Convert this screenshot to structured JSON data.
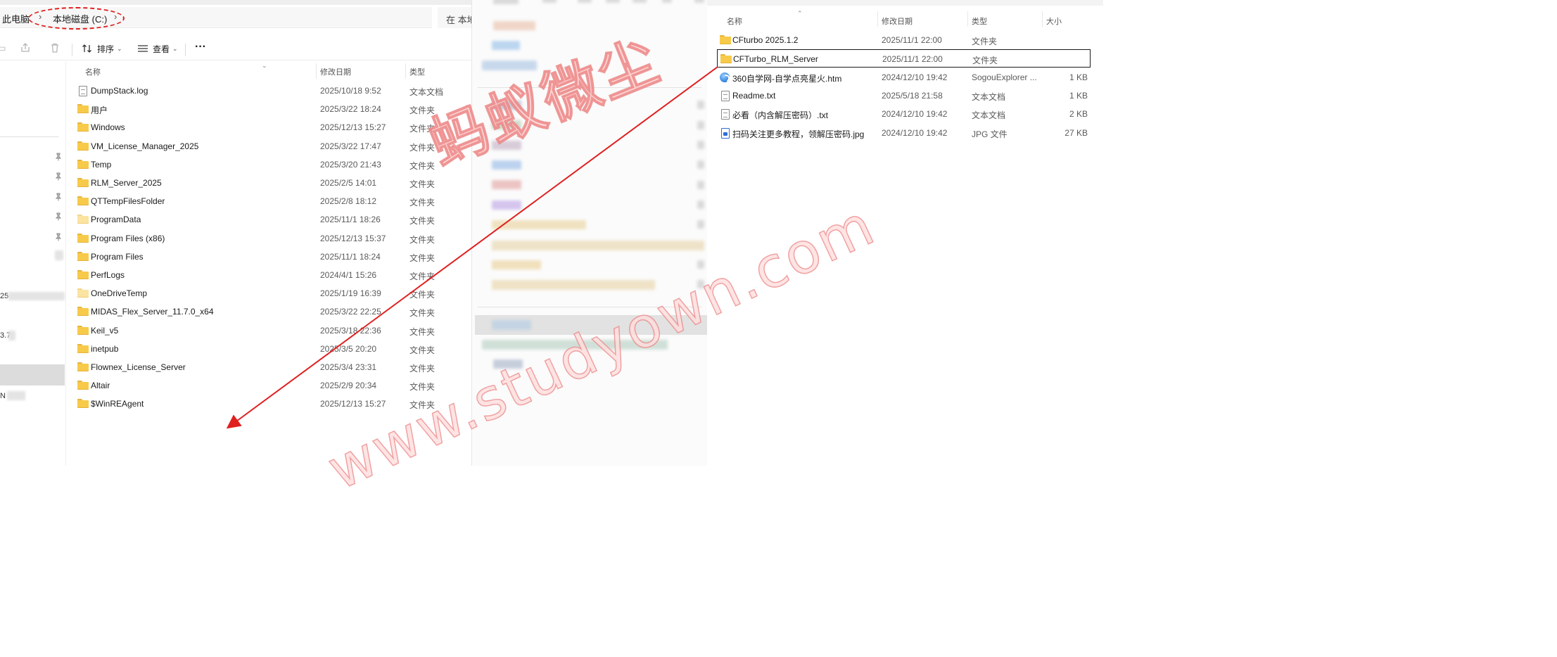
{
  "left": {
    "breadcrumb": [
      "此电脑",
      "本地磁盘 (C:)"
    ],
    "search_placeholder": "在 本地",
    "toolbar": {
      "sort_label": "排序",
      "view_label": "查看",
      "more_label": "···"
    },
    "columns": {
      "name": "名称",
      "date": "修改日期",
      "type": "类型"
    },
    "nav_partial": [
      "25",
      "3.7",
      "N"
    ],
    "files": [
      {
        "name": "DumpStack.log",
        "date": "2025/10/18 9:52",
        "type": "文本文档",
        "icon": "text-file-icon"
      },
      {
        "name": "用户",
        "date": "2025/3/22 18:24",
        "type": "文件夹",
        "icon": "folder-icon"
      },
      {
        "name": "Windows",
        "date": "2025/12/13 15:27",
        "type": "文件夹",
        "icon": "folder-icon"
      },
      {
        "name": "VM_License_Manager_2025",
        "date": "2025/3/22 17:47",
        "type": "文件夹",
        "icon": "folder-icon"
      },
      {
        "name": "Temp",
        "date": "2025/3/20 21:43",
        "type": "文件夹",
        "icon": "folder-icon"
      },
      {
        "name": "RLM_Server_2025",
        "date": "2025/2/5 14:01",
        "type": "文件夹",
        "icon": "folder-icon"
      },
      {
        "name": "QTTempFilesFolder",
        "date": "2025/2/8 18:12",
        "type": "文件夹",
        "icon": "folder-icon"
      },
      {
        "name": "ProgramData",
        "date": "2025/11/1 18:26",
        "type": "文件夹",
        "icon": "folder-light-icon"
      },
      {
        "name": "Program Files (x86)",
        "date": "2025/12/13 15:37",
        "type": "文件夹",
        "icon": "folder-icon"
      },
      {
        "name": "Program Files",
        "date": "2025/11/1 18:24",
        "type": "文件夹",
        "icon": "folder-icon"
      },
      {
        "name": "PerfLogs",
        "date": "2024/4/1 15:26",
        "type": "文件夹",
        "icon": "folder-icon"
      },
      {
        "name": "OneDriveTemp",
        "date": "2025/1/19 16:39",
        "type": "文件夹",
        "icon": "folder-light-icon"
      },
      {
        "name": "MIDAS_Flex_Server_11.7.0_x64",
        "date": "2025/3/22 22:25",
        "type": "文件夹",
        "icon": "folder-icon"
      },
      {
        "name": "Keil_v5",
        "date": "2025/3/18 22:36",
        "type": "文件夹",
        "icon": "folder-icon"
      },
      {
        "name": "inetpub",
        "date": "2025/3/5 20:20",
        "type": "文件夹",
        "icon": "folder-icon"
      },
      {
        "name": "Flownex_License_Server",
        "date": "2025/3/4 23:31",
        "type": "文件夹",
        "icon": "folder-icon"
      },
      {
        "name": "Altair",
        "date": "2025/2/9 20:34",
        "type": "文件夹",
        "icon": "folder-icon"
      },
      {
        "name": "$WinREAgent",
        "date": "2025/12/13 15:27",
        "type": "文件夹",
        "icon": "folder-icon"
      }
    ]
  },
  "right": {
    "columns": {
      "name": "名称",
      "date": "修改日期",
      "type": "类型",
      "size": "大小"
    },
    "files": [
      {
        "name": "CFturbo 2025.1.2",
        "date": "2025/11/1 22:00",
        "type": "文件夹",
        "size": "",
        "icon": "folder-icon"
      },
      {
        "name": "CFTurbo_RLM_Server",
        "date": "2025/11/1 22:00",
        "type": "文件夹",
        "size": "",
        "icon": "folder-icon",
        "selected": true
      },
      {
        "name": "360自学网-自学点亮星火.htm",
        "date": "2024/12/10 19:42",
        "type": "SogouExplorer ...",
        "size": "1 KB",
        "icon": "browser-html-icon"
      },
      {
        "name": "Readme.txt",
        "date": "2025/5/18 21:58",
        "type": "文本文档",
        "size": "1 KB",
        "icon": "text-file-icon"
      },
      {
        "name": "必看（内含解压密码）.txt",
        "date": "2024/12/10 19:42",
        "type": "文本文档",
        "size": "2 KB",
        "icon": "text-file-icon"
      },
      {
        "name": "扫码关注更多教程，领解压密码.jpg",
        "date": "2024/12/10 19:42",
        "type": "JPG 文件",
        "size": "27 KB",
        "icon": "image-file-icon"
      }
    ]
  },
  "watermarks": {
    "chinese": "蚂蚁微尘",
    "url": "www.studyown.com"
  },
  "colors": {
    "annotation_red": "#e02020",
    "folder_yellow": "#f8ca4a",
    "selection_gray": "#dcdcdc"
  }
}
